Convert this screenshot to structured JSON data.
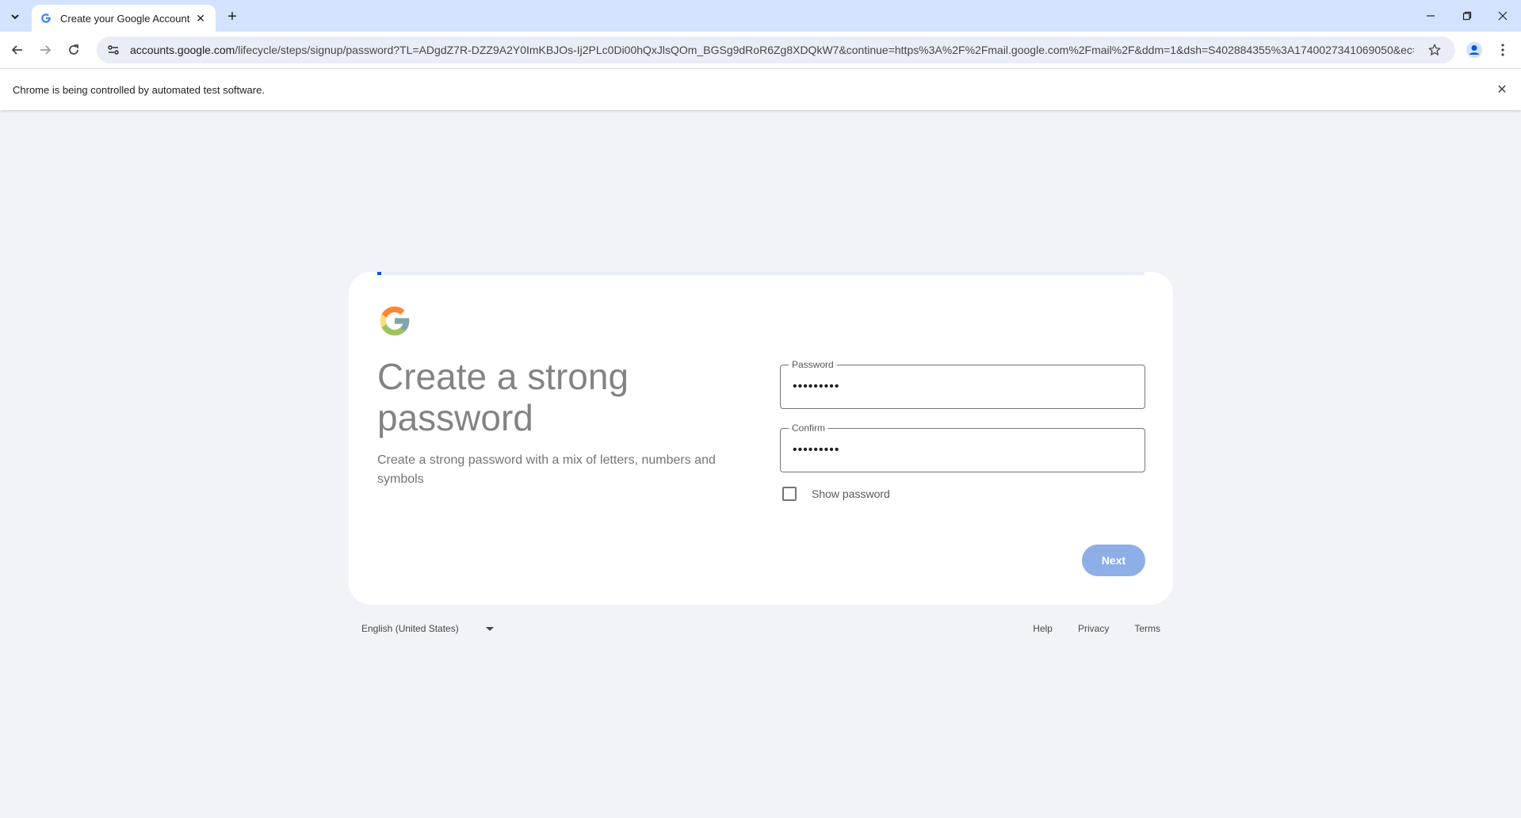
{
  "browser": {
    "tab_title": "Create your Google Account",
    "url_host": "accounts.google.com",
    "url_path": "/lifecycle/steps/signup/password?TL=ADgdZ7R-DZZ9A2Y0ImKBJOs-Ij2PLc0Di00hQxJlsQOm_BGSg9dRoR6Zg8XDQkW7&continue=https%3A%2F%2Fmail.google.com%2Fmail%2F&ddm=1&dsh=S402884355%3A1740027341069050&ec=asw-...",
    "infobar_text": "Chrome is being controlled by automated test software."
  },
  "signup": {
    "progress": 0.005,
    "heading": "Create a strong password",
    "subtext": "Create a strong password with a mix of letters, numbers and symbols",
    "password_label": "Password",
    "password_value": "•••••••••",
    "confirm_label": "Confirm",
    "confirm_value": "•••••••••",
    "show_password_label": "Show password",
    "show_password_checked": false,
    "next_label": "Next"
  },
  "footer": {
    "language": "English (United States)",
    "links": [
      "Help",
      "Privacy",
      "Terms"
    ]
  },
  "colors": {
    "accent": "#0b57d0",
    "next_button": "#8eaee8",
    "page_background": "#f0f4f9",
    "tabstrip": "#d3e3fd"
  }
}
